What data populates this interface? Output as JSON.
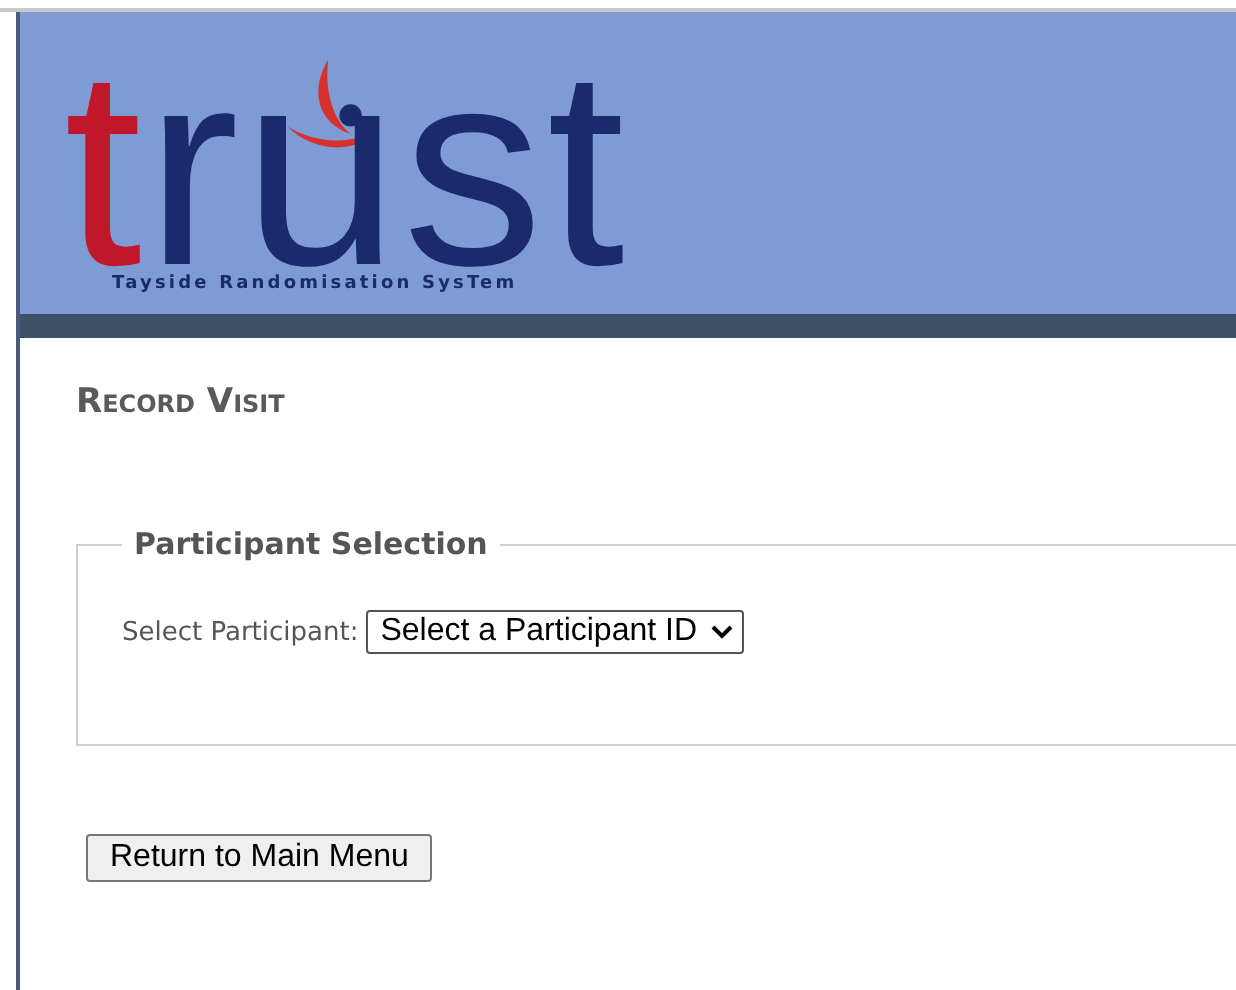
{
  "banner": {
    "logo_parts": [
      {
        "text": "t",
        "color": "#c0172b"
      },
      {
        "text": "rust",
        "color": "#1a2a6c"
      }
    ],
    "tagline": "Tayside Randomisation SysTem"
  },
  "heading": "Record Visit",
  "fieldset": {
    "legend": "Participant Selection",
    "label": "Select Participant:",
    "select_value": "Select a Participant ID"
  },
  "buttons": [
    "Return to Main Menu"
  ]
}
